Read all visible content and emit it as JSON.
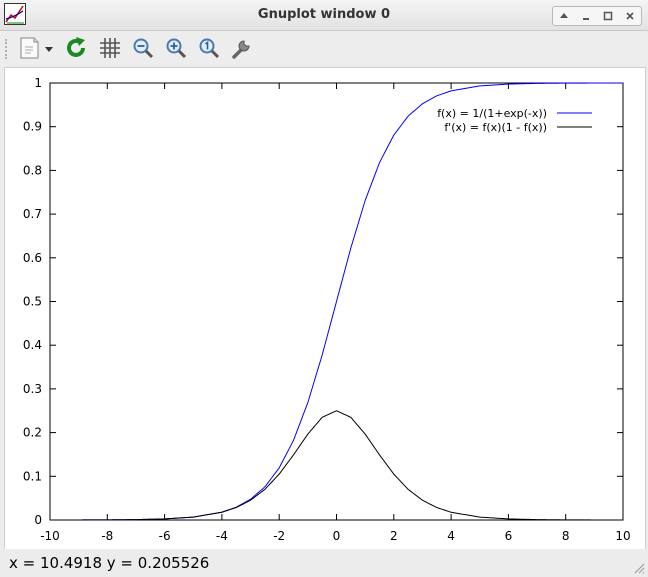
{
  "window": {
    "title": "Gnuplot window 0"
  },
  "toolbar": {
    "items": [
      {
        "name": "copy-export",
        "icon": "page-icon"
      },
      {
        "name": "replot",
        "icon": "refresh-icon"
      },
      {
        "name": "grid",
        "icon": "grid-icon"
      },
      {
        "name": "zoom-previous",
        "icon": "zoom-out-icon"
      },
      {
        "name": "zoom-next",
        "icon": "zoom-in-icon"
      },
      {
        "name": "autoscale",
        "icon": "zoom-1-icon"
      },
      {
        "name": "configure",
        "icon": "wrench-icon"
      }
    ]
  },
  "status": {
    "text": "x = 10.4918 y = 0.205526"
  },
  "chart_data": {
    "type": "line",
    "xlim": [
      -10,
      10
    ],
    "ylim": [
      0,
      1
    ],
    "xticks": [
      "-10",
      "-8",
      "-6",
      "-4",
      "-2",
      "0",
      "2",
      "4",
      "6",
      "8",
      "10"
    ],
    "yticks": [
      "0",
      "0.1",
      "0.2",
      "0.3",
      "0.4",
      "0.5",
      "0.6",
      "0.7",
      "0.8",
      "0.9",
      "1"
    ],
    "grid": false,
    "legend_position": "top-right",
    "x": [
      -10,
      -9,
      -8,
      -7,
      -6,
      -5,
      -4,
      -3.5,
      -3,
      -2.5,
      -2,
      -1.5,
      -1,
      -0.5,
      0,
      0.5,
      1,
      1.5,
      2,
      2.5,
      3,
      3.5,
      4,
      5,
      6,
      7,
      8,
      9,
      10
    ],
    "series": [
      {
        "name": "f(x) = 1/(1+exp(-x))",
        "color": "#0000ff",
        "values": [
          4.54e-05,
          0.000123,
          0.000335,
          0.000911,
          0.00247,
          0.00669,
          0.018,
          0.0293,
          0.0474,
          0.0759,
          0.1192,
          0.1824,
          0.2689,
          0.3775,
          0.5,
          0.6225,
          0.7311,
          0.8176,
          0.8808,
          0.9241,
          0.9526,
          0.9707,
          0.982,
          0.9933,
          0.9975,
          0.9991,
          0.9997,
          0.9999,
          1.0
        ]
      },
      {
        "name": "f'(x) = f(x)(1 - f(x))",
        "color": "#000000",
        "values": [
          4.54e-05,
          0.000123,
          0.000335,
          0.00091,
          0.00247,
          0.00665,
          0.0177,
          0.0285,
          0.0452,
          0.0701,
          0.105,
          0.1491,
          0.1966,
          0.235,
          0.25,
          0.235,
          0.1966,
          0.1491,
          0.105,
          0.0701,
          0.0452,
          0.0285,
          0.0177,
          0.00665,
          0.00247,
          0.00091,
          0.000335,
          0.000123,
          4.54e-05
        ]
      }
    ]
  }
}
